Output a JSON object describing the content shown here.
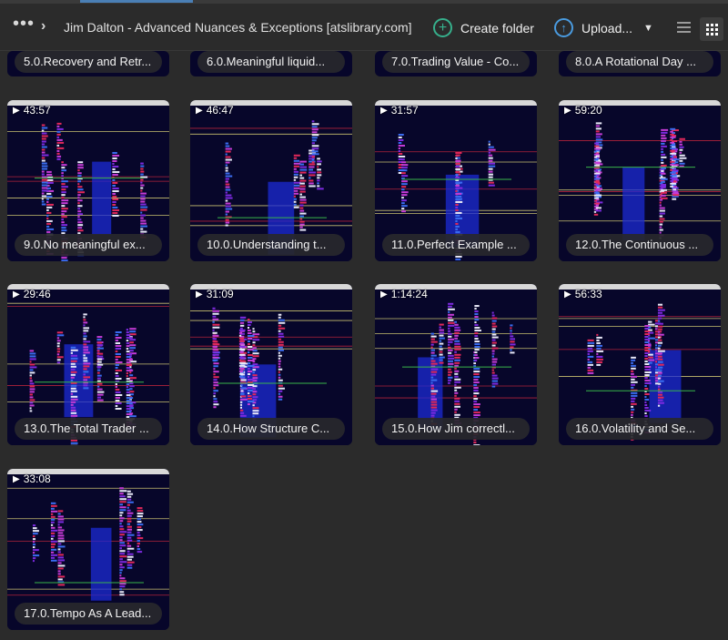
{
  "toolbar": {
    "more_label": "•••",
    "chevron": "›",
    "breadcrumb": "Jim Dalton - Advanced Nuances & Exceptions [atslibrary.com]",
    "create_folder": "Create folder",
    "create_icon": "+",
    "upload": "Upload...",
    "upload_icon": "↑",
    "upload_caret": "▼"
  },
  "colors": {
    "accent_green": "#36b08c",
    "accent_blue": "#4a9be0",
    "background": "#2b2b2b",
    "chart_bg": "#07062a"
  },
  "top_row": [
    {
      "title": "5.0.Recovery and Retr..."
    },
    {
      "title": "6.0.Meaningful liquid..."
    },
    {
      "title": "7.0.Trading Value - Co..."
    },
    {
      "title": "8.0.A Rotational Day ..."
    }
  ],
  "videos": [
    {
      "duration": "43:57",
      "title": "9.0.No meaningful ex..."
    },
    {
      "duration": "46:47",
      "title": "10.0.Understanding t..."
    },
    {
      "duration": "31:57",
      "title": "11.0.Perfect Example ..."
    },
    {
      "duration": "59:20",
      "title": "12.0.The Continuous ..."
    },
    {
      "duration": "29:46",
      "title": "13.0.The Total Trader ..."
    },
    {
      "duration": "31:09",
      "title": "14.0.How Structure C..."
    },
    {
      "duration": "1:14:24",
      "title": "15.0.How Jim correctl..."
    },
    {
      "duration": "56:33",
      "title": "16.0.Volatility and Se..."
    },
    {
      "duration": "33:08",
      "title": "17.0.Tempo As A Lead..."
    }
  ],
  "icons": {
    "play": "▶"
  }
}
